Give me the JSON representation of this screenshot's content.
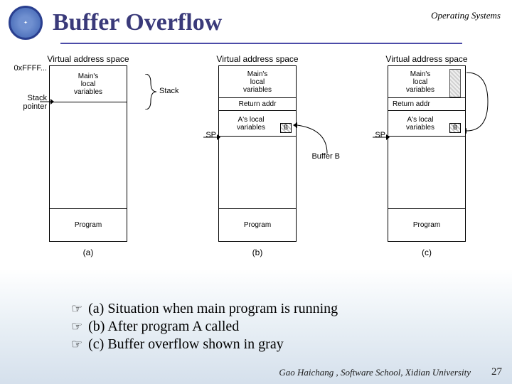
{
  "header": {
    "title": "Buffer Overflow",
    "course": "Operating Systems"
  },
  "figure": {
    "vas": "Virtual address space",
    "hex_top": "0xFFFF...",
    "labels": {
      "main_vars": "Main's\nlocal\nvariables",
      "return_addr": "Return addr",
      "a_vars": "A's local\nvariables",
      "program": "Program",
      "stack_ptr": "Stack\npointer",
      "stack": "Stack",
      "sp": "SP",
      "buffer_b": "Buffer B",
      "buf_letter": "B"
    },
    "captions": {
      "a": "(a)",
      "b": "(b)",
      "c": "(c)"
    }
  },
  "bullets": {
    "a": "(a) Situation when main program is running",
    "b": "(b) After program A called",
    "c": "(c) Buffer overflow shown in gray"
  },
  "footer": {
    "credit": "Gao Haichang , Software School, Xidian University",
    "page": "27"
  }
}
